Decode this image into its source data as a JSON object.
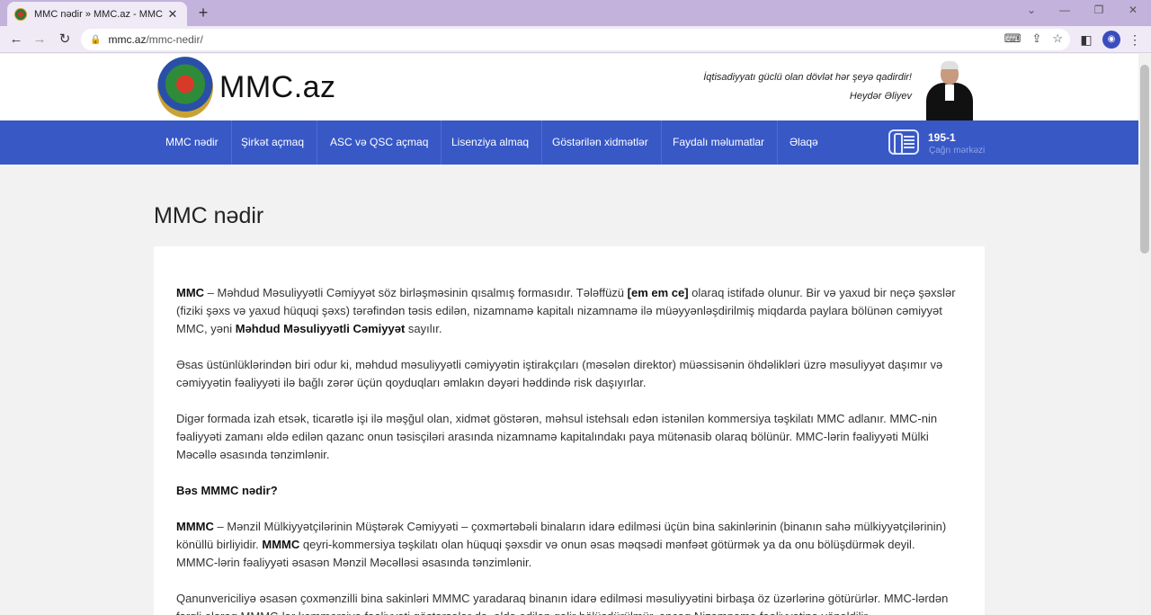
{
  "browser": {
    "tab_title": "MMC nədir » MMC.az - MMC açı",
    "close_glyph": "✕",
    "new_tab_glyph": "+",
    "url_host": "mmc.az",
    "url_path": "/mmc-nedir/"
  },
  "site": {
    "logo_text": "MMC.az",
    "quote_text": "İqtisadiyyatı güclü olan dövlət hər şeyə qadirdir!",
    "quote_author": "Heydər Əliyev",
    "nav": [
      "MMC nədir",
      "Şirkət açmaq",
      "ASC və QSC açmaq",
      "Lisenziya almaq",
      "Göstərilən xidmətlər",
      "Faydalı məlumatlar",
      "Əlaqə"
    ],
    "phone_number": "195-1",
    "phone_label": "Çağrı mərkəzi"
  },
  "article": {
    "title": "MMC nədir",
    "p1_b1": "MMC",
    "p1_t1": " – Məhdud Məsuliyyətli Cəmiyyət söz birləşməsinin qısalmış formasıdır. Tələffüzü ",
    "p1_b2": "[em em ce]",
    "p1_t2": " olaraq istifadə olunur. Bir və yaxud bir neçə şəxslər (fiziki şəxs və yaxud hüquqi şəxs) tərəfindən təsis edilən, nizamnamə kapitalı nizamnamə ilə müəyyənləşdirilmiş miqdarda paylara bölünən cəmiyyət MMC, yəni ",
    "p1_b3": "Məhdud Məsuliyyətli Cəmiyyət",
    "p1_t3": " sayılır.",
    "p2": "Əsas üstünlüklərindən biri odur ki, məhdud məsuliyyətli cəmiyyətin iştirakçıları (məsələn direktor) müəssisənin öhdəlikləri üzrə məsuliyyət daşımır və cəmiyyətin fəaliyyəti ilə bağlı zərər üçün qoyduqları əmlakın dəyəri həddində risk daşıyırlar.",
    "p3": "Digər formada izah etsək, ticarətlə işi ilə məşğul olan, xidmət göstərən, məhsul istehsalı edən istənilən kommersiya təşkilatı MMC adlanır. MMC-nin fəaliyyəti zamanı əldə edilən qazanc onun təsisçiləri arasında nizamnamə kapitalındakı paya mütənasib olaraq bölünür. MMC-lərin fəaliyyəti Mülki Məcəllə əsasında tənzimlənir.",
    "h_mmmc": "Bəs MMMC nədir?",
    "p4_b1": "MMMC",
    "p4_t1": " – Mənzil Mülkiyyətçilərinin Müştərək Cəmiyyəti – çoxmərtəbəli binaların idarə edilməsi üçün bina sakinlərinin (binanın sahə mülkiyyətçilərinin) könüllü birliyidir. ",
    "p4_b2": "MMMC",
    "p4_t2": " qeyri-kommersiya təşkilatı olan hüquqi şəxsdir və onun əsas məqsədi mənfəət götürmək ya da onu bölüşdürmək deyil. MMMC-lərin fəaliyyəti əsasən Mənzil Məcəlləsi əsasında tənzimlənir.",
    "p5": "Qanunvericiliyə əsasən çoxmənzilli bina sakinləri MMMC yaradaraq binanın idarə edilməsi məsuliyyətini birbaşa öz üzərlərinə götürürlər. MMC-lərdən fərqli olaraq MMMC-lər kommersiya fəaliyyəti göstərsələr də, əldə edilən gəlir bölüşdürülmür, ancaq Nizamnamə fəaliyyətinə yönəldilir."
  }
}
